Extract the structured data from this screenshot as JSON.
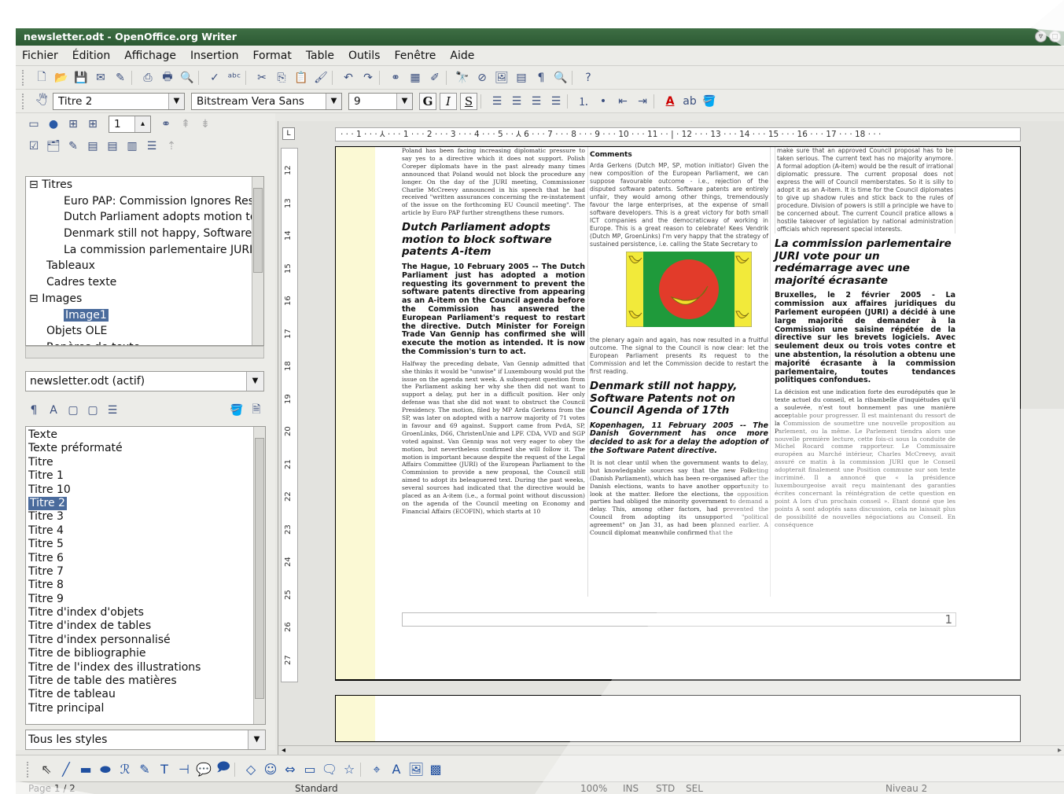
{
  "window": {
    "title": "newsletter.odt - OpenOffice.org Writer"
  },
  "menu": [
    "Fichier",
    "Édition",
    "Affichage",
    "Insertion",
    "Format",
    "Table",
    "Outils",
    "Fenêtre",
    "Aide"
  ],
  "format_toolbar": {
    "style": "Titre 2",
    "font": "Bitstream Vera Sans",
    "size": "9",
    "bold": "G",
    "italic": "I",
    "underline": "S"
  },
  "navigator": {
    "page_number": "1",
    "tree": [
      {
        "label": "Titres",
        "indent": 0,
        "expander": "⊟"
      },
      {
        "label": "Euro PAP: Commission Ignores Res",
        "indent": 2
      },
      {
        "label": "Dutch Parliament adopts motion to b",
        "indent": 2
      },
      {
        "label": "Denmark still not happy, Software P",
        "indent": 2
      },
      {
        "label": "La commission parlementaire JURI",
        "indent": 2
      },
      {
        "label": "Tableaux",
        "indent": 1
      },
      {
        "label": "Cadres texte",
        "indent": 1
      },
      {
        "label": "Images",
        "indent": 0,
        "expander": "⊟"
      },
      {
        "label": "Image1",
        "indent": 2,
        "selected": true
      },
      {
        "label": "Objets OLE",
        "indent": 1
      },
      {
        "label": "Repères de texte",
        "indent": 1
      }
    ],
    "document": "newsletter.odt (actif)"
  },
  "styles": {
    "items": [
      "Texte",
      "Texte préformaté",
      "Titre",
      "Titre 1",
      "Titre 10",
      "Titre 2",
      "Titre 3",
      "Titre 4",
      "Titre 5",
      "Titre 6",
      "Titre 7",
      "Titre 8",
      "Titre 9",
      "Titre d'index d'objets",
      "Titre d'index de tables",
      "Titre d'index personnalisé",
      "Titre de bibliographie",
      "Titre de l'index des illustrations",
      "Titre de table des matières",
      "Titre de tableau",
      "Titre principal"
    ],
    "selected": "Titre 2",
    "filter": "Tous les styles"
  },
  "ruler": {
    "h": "· · · 1 · · · ⅄ · · · 1 · · · 2 · · · 3 · · · 4 · · · 5 · · ⅄ 6 · · · 7 · · · 8 · · · 9 · · · 10 · · · 11 · · | · 12 · · · 13 · · · 14 · · · 15 · · · 16 · · · 17 · · · 18 · · ·",
    "v": [
      "12",
      "13",
      "14",
      "15",
      "16",
      "17",
      "18",
      "19",
      "20",
      "21",
      "22",
      "23",
      "24",
      "25",
      "26",
      "27"
    ]
  },
  "doc": {
    "col1_top": "Poland has been facing increasing diplomatic pressure to say yes to a directive which it does not support. Polish Coreper diplomats have in the past already many times announced that Poland would not block the procedure any longer. On the day of the JURI meeting, Commissioner Charlie McCreevy announced in his speech that he had received \"written assurances concerning the re-instatement of the issue on the forthcoming EU Council meeting\". The article by Euro PAP further strengthens these rumors.",
    "h_dutch": "Dutch Parliament adopts motion to block software patents A-item",
    "lead_dutch": "The Hague, 10 February 2005 -- The Dutch Parliament just has adopted a motion requesting its government to prevent the software patents directive from appearing as an A-item on the Council agenda before the Commission has answered the European Parliament's request to restart the directive. Dutch Minister for Foreign Trade Van Gennip has confirmed she will execute the motion as intended. It is now the Commission's turn to act.",
    "body_dutch": "Halfway the preceding debate, Van Gennip admitted that she thinks it would be \"unwise\" if Luxembourg would put the issue on the agenda next week. A subsequent question from the Parliament asking her why she then did not want to support a delay, put her in a difficult position. Her only defense was that she did not want to obstruct the Council Presidency. The motion, filed by MP Arda Gerkens from the SP, was later on adopted with a narrow majority of 71 votes in favour and 69 against. Support came from PvdA, SP, GroenLinks, D66, ChristenUnie and LPF. CDA, VVD and SGP voted against. Van Gennip was not very eager to obey the motion, but nevertheless confirmed she will follow it. The motion is important because despite the request of the Legal Affairs Committee (JURI) of the European Parliament to the Commission to provide a new proposal, the Council still aimed to adopt its beleaguered text. During the past weeks, several sources had indicated that the directive would be placed as an A-item (i.e., a formal point without discussion) on the agenda of the Council meeting on Economy and Financial Affairs (ECOFIN), which starts at 10",
    "comments_title": "Comments",
    "comments": "Arda Gerkens (Dutch MP, SP, motion initiator) Given the new composition of the European Parliament, we can suppose favourable outcome - i.e., rejection of the disputed software patents. Software patents are entirely unfair, they would among other things, tremendously favour the large enterprises, at the expense of small software developers. This is a great victory for both small ICT companies and the democraticway of working in Europe. This is a great reason to celebrate! Kees Vendrik (Dutch MP, GroenLinks) I'm very happy that the strategy of sustained persistence, i.e. calling the State Secretary to",
    "comments_after": "the plenary again and again, has now resulted in a fruitful outcome. The signal to the Council is now clear: let the European Parliament presents its request to the Commission and let the Commission decide to restart the first reading.",
    "h_denmark": "Denmark still not happy, Software Patents not on Council Agenda of 17th",
    "lead_denmark": "Kopenhagen, 11 February 2005 -- The Danish Government has once more decided to ask for a delay the adoption of the Software Patent directive.",
    "body_denmark": "It is not clear until when the government wants to delay, but knowledgable sources say that the new Folketing (Danish Parliament), which has been re-organised after the Danish elections, wants to have another opportunity to look at the matter. Before the elections, the opposition parties had obliged the minority government to demand a delay. This, among other factors, had prevented the Council from adopting its unsupported \"political agreement\" on Jan 31, as had been planned earlier. A Council diplomat meanwhile confirmed that the",
    "col3_top": "make sure that an approved Council proposal has to be taken serious. The current text has no majority anymore. A formal adoption (A-item) would be the result of irrational diplomatic pressure. The current proposal does not express the will of Council memberstates. So it is silly to adopt it as an A-item. It is time for the Council diplomates to give up shadow rules and stick back to the rules of procedure. Division of powers is still a principle we have to be concerned about. The current Council pratice allows a hostile takeover of legislation by national administration officials which represent special interests.",
    "h_juri": "La commission parlementaire JURI vote pour un redémarrage avec une majorité écrasante",
    "lead_juri": "Bruxelles, le 2 février 2005 - La commission aux affaires juridiques du Parlement européen (JURI) a décidé à une large majorité de demander à la Commission une saisine répétée de la directive sur les brevets logiciels. Avec seulement deux ou trois votes contre et une abstention, la résolution a obtenu une majorité écrasante à la commission parlementaire, toutes tendances politiques confondues.",
    "body_juri": "La décision est une indication forte des eurodéputés que le texte actuel du conseil, et la ribambelle d'inquiétudes qu'il a soulevée, n'est tout bonnement pas une manière acceptable pour progresser. Il est maintenant du ressort de la Commission de soumettre une nouvelle proposition au Parlement, ou la même. Le Parlement tiendra alors une nouvelle première lecture, cette fois-ci sous la conduite de Michel Rocard comme rapporteur. Le Commissaire européen au Marché intérieur, Charles McCreevy, avait assuré ce matin à la commission JURI que le Conseil adopterait finalement une Position commune sur son texte incriminé. Il a annoncé que « la présidence luxembourgeoise avait reçu maintenant des garanties écrites concernant la réintégration de cette question en point A lors d'un prochain conseil ». Etant donné que les points A sont adoptés sans discussion, cela ne laissait plus de possibilité de nouvelles négociations au Conseil. En conséquence",
    "page_num": "1"
  },
  "status": {
    "page": "Page 1 / 2",
    "style": "Standard",
    "zoom": "100%",
    "ins": "INS",
    "std": "STD",
    "sel": "SEL",
    "level": "Niveau 2"
  },
  "colors": {
    "title_bg": "#2f5d36",
    "selection": "#4a6b9c",
    "yellow": "#fbf9d4"
  }
}
